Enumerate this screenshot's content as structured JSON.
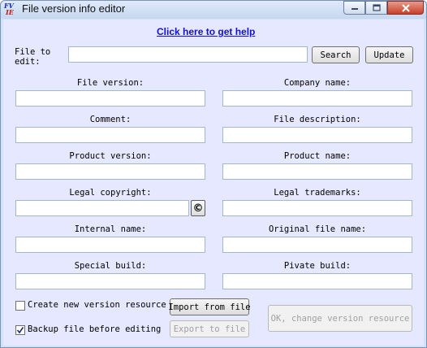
{
  "window": {
    "title": "File version info editor",
    "icon_text_1": "FV",
    "icon_text_2": "IE"
  },
  "help_link": "Click here to get help",
  "file_to_edit": {
    "label": "File to edit:",
    "value": "",
    "search_label": "Search",
    "update_label": "Update"
  },
  "fields": {
    "file_version": {
      "label": "File version:",
      "value": ""
    },
    "company_name": {
      "label": "Company name:",
      "value": ""
    },
    "comment": {
      "label": "Comment:",
      "value": ""
    },
    "file_description": {
      "label": "File description:",
      "value": ""
    },
    "product_version": {
      "label": "Product version:",
      "value": ""
    },
    "product_name": {
      "label": "Product name:",
      "value": ""
    },
    "legal_copyright": {
      "label": "Legal copyright:",
      "value": "",
      "button_symbol": "©"
    },
    "legal_trademarks": {
      "label": "Legal trademarks:",
      "value": ""
    },
    "internal_name": {
      "label": "Internal name:",
      "value": ""
    },
    "original_file_name": {
      "label": "Original file name:",
      "value": ""
    },
    "special_build": {
      "label": "Special build:",
      "value": ""
    },
    "private_build": {
      "label": "Pivate build:",
      "value": ""
    }
  },
  "options": {
    "create_new_version": {
      "label": "Create new version resource",
      "checked": false
    },
    "backup_file": {
      "label": "Backup file before editing",
      "checked": true
    }
  },
  "buttons": {
    "import_from_file": "Import from file",
    "export_to_file": "Export to file",
    "ok_change": "OK, change version resource"
  },
  "icons": {
    "minimize": "minimize-icon",
    "maximize": "maximize-icon",
    "close": "close-icon",
    "copyright": "copyright-icon",
    "check": "checkmark-icon"
  }
}
